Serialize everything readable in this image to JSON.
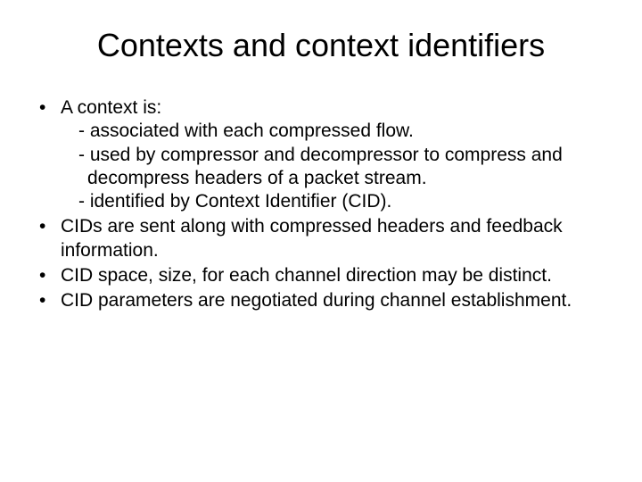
{
  "title": "Contexts and context identifiers",
  "bullets": {
    "b1": {
      "lead": "A context is:",
      "s1": "- associated with each compressed flow.",
      "s2": "- used by compressor and decompressor to compress and decompress headers of a packet stream.",
      "s3": "- identified by Context Identifier (CID)."
    },
    "b2": "CIDs are sent along with compressed headers and feedback information.",
    "b3": "CID space, size, for each channel direction may be distinct.",
    "b4": "CID parameters are negotiated during channel establishment."
  }
}
